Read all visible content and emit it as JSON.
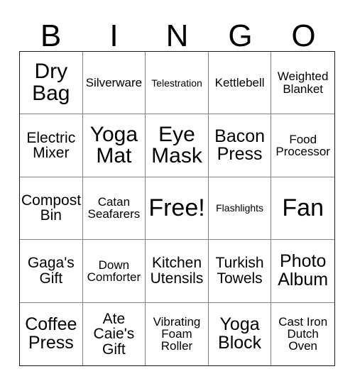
{
  "card": {
    "header_letters": [
      "B",
      "I",
      "N",
      "G",
      "O"
    ],
    "columns": 5,
    "rows": 5,
    "free_space_label": "Free!",
    "free_space_position": "center",
    "colors": {
      "background": "#ffffff",
      "text": "#000000",
      "outer_border": "#1a1a1a",
      "inner_grid_line": "#808080"
    },
    "cells": [
      {
        "text": "Dry\nBag",
        "size": "xl",
        "row": 1,
        "col": 1,
        "free": false
      },
      {
        "text": "Silverware",
        "size": "sm",
        "row": 1,
        "col": 2,
        "free": false
      },
      {
        "text": "Telestration",
        "size": "xs",
        "row": 1,
        "col": 3,
        "free": false
      },
      {
        "text": "Kettlebell",
        "size": "sm",
        "row": 1,
        "col": 4,
        "free": false
      },
      {
        "text": "Weighted\nBlanket",
        "size": "sm",
        "row": 1,
        "col": 5,
        "free": false
      },
      {
        "text": "Electric\nMixer",
        "size": "md",
        "row": 2,
        "col": 1,
        "free": false
      },
      {
        "text": "Yoga\nMat",
        "size": "xl",
        "row": 2,
        "col": 2,
        "free": false
      },
      {
        "text": "Eye\nMask",
        "size": "xl",
        "row": 2,
        "col": 3,
        "free": false
      },
      {
        "text": "Bacon\nPress",
        "size": "lg",
        "row": 2,
        "col": 4,
        "free": false
      },
      {
        "text": "Food\nProcessor",
        "size": "sm",
        "row": 2,
        "col": 5,
        "free": false
      },
      {
        "text": "Compost\nBin",
        "size": "md",
        "row": 3,
        "col": 1,
        "free": false
      },
      {
        "text": "Catan\nSeafarers",
        "size": "sm",
        "row": 3,
        "col": 2,
        "free": false
      },
      {
        "text": "Free!",
        "size": "xxl",
        "row": 3,
        "col": 3,
        "free": true
      },
      {
        "text": "Flashlights",
        "size": "xs",
        "row": 3,
        "col": 4,
        "free": false
      },
      {
        "text": "Fan",
        "size": "xxl",
        "row": 3,
        "col": 5,
        "free": false
      },
      {
        "text": "Gaga's\nGift",
        "size": "md",
        "row": 4,
        "col": 1,
        "free": false
      },
      {
        "text": "Down\nComforter",
        "size": "sm",
        "row": 4,
        "col": 2,
        "free": false
      },
      {
        "text": "Kitchen\nUtensils",
        "size": "md",
        "row": 4,
        "col": 3,
        "free": false
      },
      {
        "text": "Turkish\nTowels",
        "size": "md",
        "row": 4,
        "col": 4,
        "free": false
      },
      {
        "text": "Photo\nAlbum",
        "size": "lg",
        "row": 4,
        "col": 5,
        "free": false
      },
      {
        "text": "Coffee\nPress",
        "size": "lg",
        "row": 5,
        "col": 1,
        "free": false
      },
      {
        "text": "Ate\nCaie's\nGift",
        "size": "md",
        "row": 5,
        "col": 2,
        "free": false
      },
      {
        "text": "Vibrating\nFoam\nRoller",
        "size": "sm",
        "row": 5,
        "col": 3,
        "free": false
      },
      {
        "text": "Yoga\nBlock",
        "size": "lg",
        "row": 5,
        "col": 4,
        "free": false
      },
      {
        "text": "Cast Iron\nDutch\nOven",
        "size": "sm",
        "row": 5,
        "col": 5,
        "free": false
      }
    ]
  }
}
